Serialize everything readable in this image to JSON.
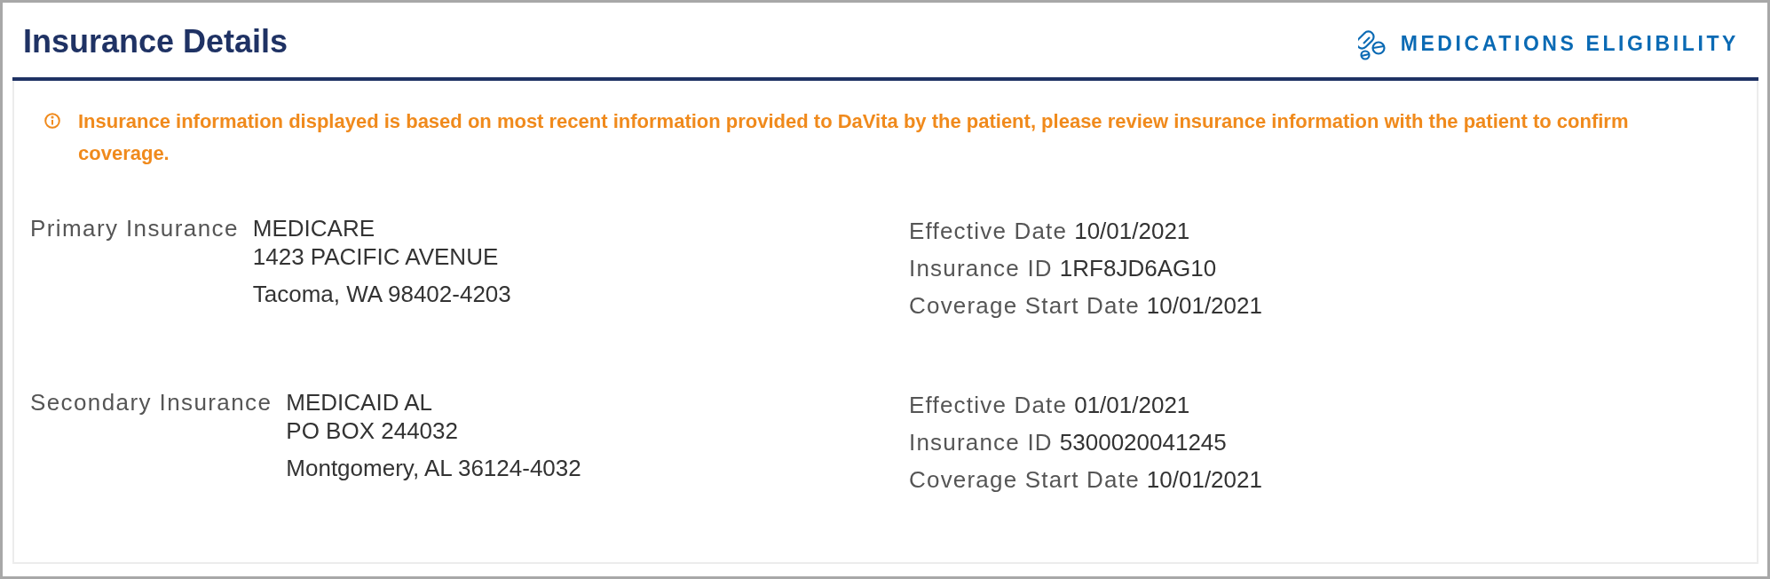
{
  "title": "Insurance Details",
  "header_link": {
    "label": "MEDICATIONS ELIGIBILITY"
  },
  "notice": "Insurance information displayed is based on most recent information provided to DaVita by the patient, please review insurance information with the patient to confirm coverage.",
  "insurances": [
    {
      "label": "Primary Insurance",
      "address": [
        "MEDICARE",
        "1423 PACIFIC AVENUE",
        "Tacoma, WA 98402-4203"
      ],
      "details": [
        {
          "label": "Effective Date",
          "value": "10/01/2021"
        },
        {
          "label": "Insurance ID",
          "value": "1RF8JD6AG10"
        },
        {
          "label": "Coverage Start Date",
          "value": "10/01/2021"
        }
      ]
    },
    {
      "label": "Secondary Insurance",
      "address": [
        "MEDICAID AL",
        "PO BOX 244032",
        "Montgomery, AL 36124-4032"
      ],
      "details": [
        {
          "label": "Effective Date",
          "value": "01/01/2021"
        },
        {
          "label": "Insurance ID",
          "value": "5300020041245"
        },
        {
          "label": "Coverage Start Date",
          "value": "10/01/2021"
        }
      ]
    }
  ]
}
